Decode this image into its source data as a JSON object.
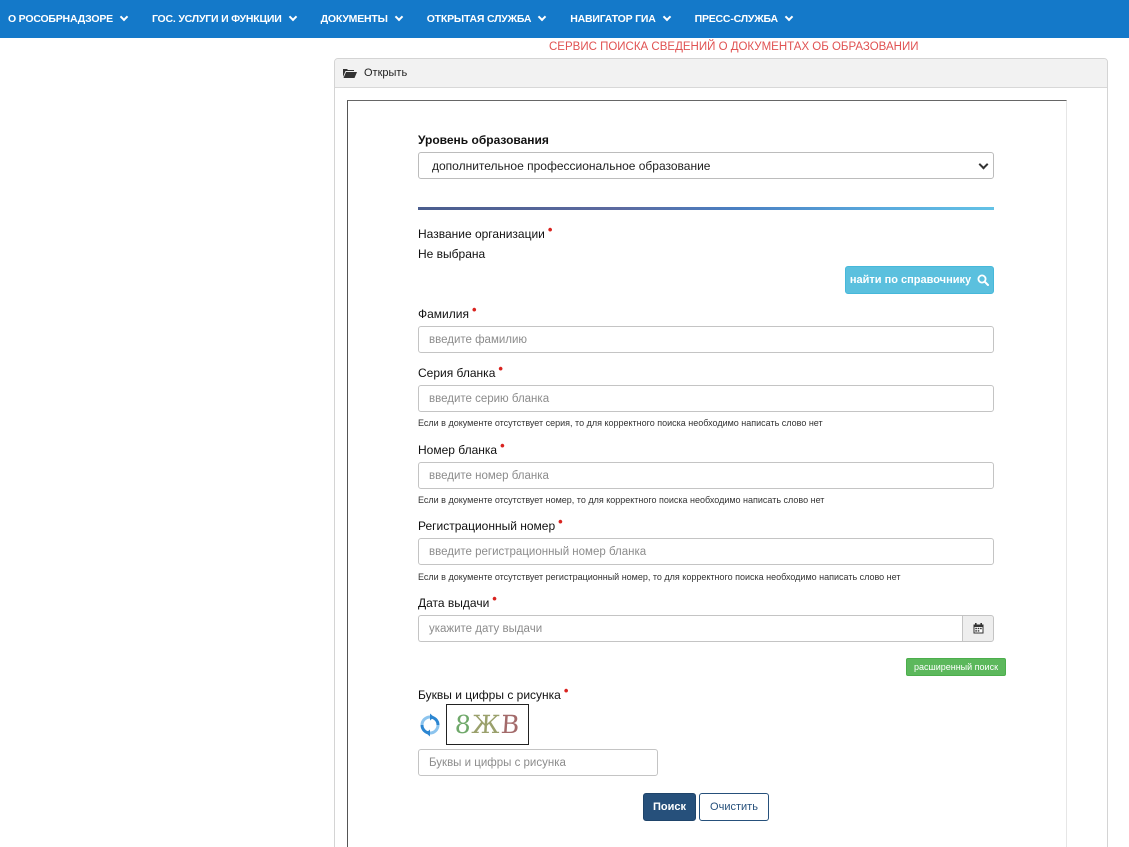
{
  "nav": {
    "items": [
      {
        "label": "О РОСОБРНАДЗОРЕ"
      },
      {
        "label": "ГОС. УСЛУГИ И ФУНКЦИИ"
      },
      {
        "label": "ДОКУМЕНТЫ"
      },
      {
        "label": "ОТКРЫТАЯ СЛУЖБА"
      },
      {
        "label": "НАВИГАТОР ГИА"
      },
      {
        "label": "ПРЕСС-СЛУЖБА"
      }
    ]
  },
  "service_title": "СЕРВИС ПОИСКА СВЕДЕНИЙ О ДОКУМЕНТАХ ОБ ОБРАЗОВАНИИ",
  "panel": {
    "heading": "Открыть",
    "heading_icon": "folder-open-icon"
  },
  "form": {
    "education_level": {
      "label": "Уровень образования",
      "selected": "дополнительное профессиональное образование"
    },
    "organization": {
      "label": "Название организации",
      "value": "Не выбрана",
      "lookup_button": "найти по справочнику",
      "lookup_icon": "search-icon"
    },
    "surname": {
      "label": "Фамилия",
      "placeholder": "введите фамилию"
    },
    "blank_series": {
      "label": "Серия бланка",
      "placeholder": "введите серию бланка",
      "help": "Если в документе отсутствует серия, то для корректного поиска необходимо написать слово нет"
    },
    "blank_number": {
      "label": "Номер бланка",
      "placeholder": "введите номер бланка",
      "help": "Если в документе отсутствует номер, то для корректного поиска необходимо написать слово нет"
    },
    "reg_number": {
      "label": "Регистрационный номер",
      "placeholder": "введите регистрационный номер бланка",
      "help": "Если в документе отсутствует регистрационный номер, то для корректного поиска необходимо написать слово нет"
    },
    "issue_date": {
      "label": "Дата выдачи",
      "placeholder": "укажите дату выдачи",
      "icon": "calendar-icon"
    },
    "advanced_search": "расширенный поиск",
    "captcha": {
      "label": "Буквы и цифры с рисунка",
      "image_text_1": "8",
      "image_text_2": "Ж",
      "image_text_3": "В",
      "placeholder": "Буквы и цифры с рисунка",
      "refresh_icon": "refresh-icon"
    },
    "search_button": "Поиск",
    "clear_button": "Очистить"
  },
  "colors": {
    "nav_bg": "#1479c9",
    "title_red": "#e05252",
    "required_red": "#d9231f",
    "info_button": "#5bc0de",
    "success_button": "#5cb85c",
    "primary_button": "#26507b"
  }
}
